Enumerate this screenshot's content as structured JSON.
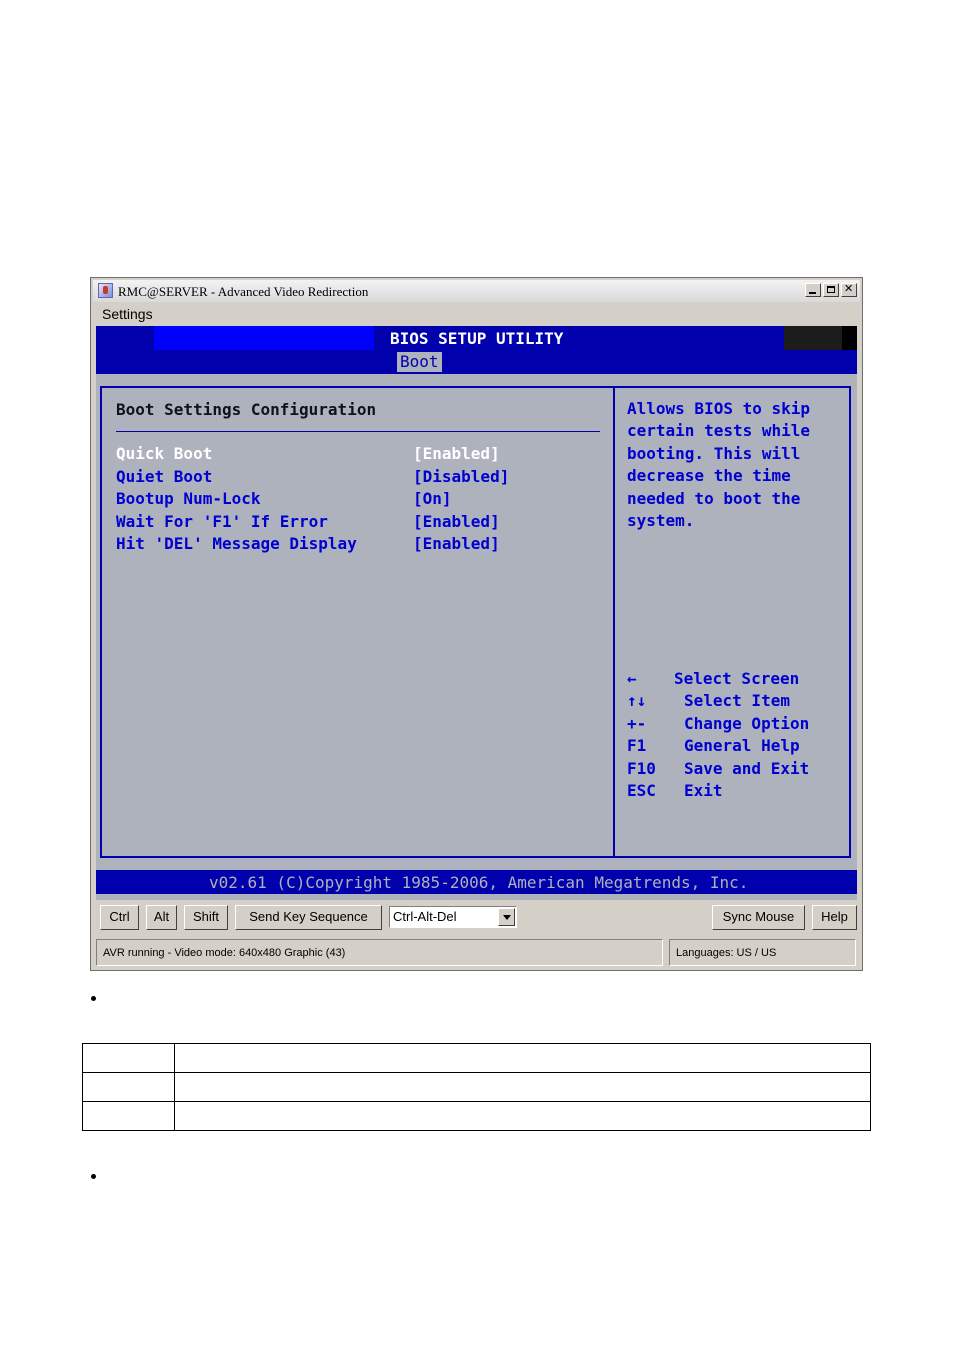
{
  "window": {
    "title": "RMC@SERVER - Advanced Video Redirection",
    "menu": [
      "Settings"
    ]
  },
  "bios": {
    "utility_title": "BIOS SETUP UTILITY",
    "active_tab": "Boot",
    "section_title": "Boot Settings Configuration",
    "options": [
      {
        "label": "Quick Boot",
        "value": "[Enabled]",
        "selected": true
      },
      {
        "label": "Quiet Boot",
        "value": "[Disabled]",
        "selected": false
      },
      {
        "label": "Bootup Num-Lock",
        "value": "[On]",
        "selected": false
      },
      {
        "label": "Wait For 'F1' If Error",
        "value": "[Enabled]",
        "selected": false
      },
      {
        "label": "Hit 'DEL' Message Display",
        "value": "[Enabled]",
        "selected": false
      }
    ],
    "help_text": [
      "Allows BIOS to skip",
      "certain tests while",
      "booting. This will",
      "decrease the time",
      "needed to boot the",
      "system."
    ],
    "key_legend": [
      {
        "key": "←",
        "desc": "Select Screen"
      },
      {
        "key": "↑↓",
        "desc": "Select Item"
      },
      {
        "key": "+-",
        "desc": "Change Option"
      },
      {
        "key": "F1",
        "desc": "General Help"
      },
      {
        "key": "F10",
        "desc": "Save and Exit"
      },
      {
        "key": "ESC",
        "desc": "Exit"
      }
    ],
    "footer": "v02.61 (C)Copyright 1985-2006, American Megatrends, Inc.",
    "colors": {
      "blue": "#0000ac",
      "grey": "#aeb2bd",
      "highlight": "#ffffff"
    }
  },
  "toolbar": {
    "ctrl": "Ctrl",
    "alt": "Alt",
    "shift": "Shift",
    "send_key_sequence": "Send Key Sequence",
    "key_sequence_selected": "Ctrl-Alt-Del",
    "sync_mouse": "Sync Mouse",
    "help": "Help"
  },
  "status": {
    "left": "AVR running - Video mode: 640x480 Graphic (43)",
    "right": "Languages: US / US"
  },
  "document": {
    "table_rows": 3,
    "table_cols": 2
  }
}
